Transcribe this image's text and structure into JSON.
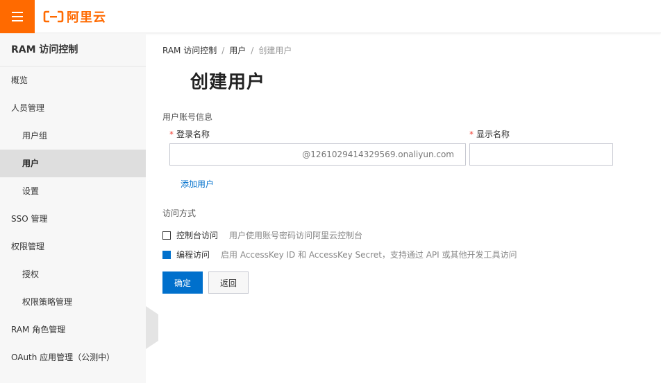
{
  "header": {
    "brand_text": "阿里云",
    "brand_color": "#ff6a00",
    "menu_icon": "hamburger-icon"
  },
  "sidebar": {
    "title": "RAM 访问控制",
    "items": [
      {
        "label": "概览"
      },
      {
        "label": "人员管理"
      },
      {
        "label": "用户组"
      },
      {
        "label": "用户"
      },
      {
        "label": "设置"
      },
      {
        "label": "SSO 管理"
      },
      {
        "label": "权限管理"
      },
      {
        "label": "授权"
      },
      {
        "label": "权限策略管理"
      },
      {
        "label": "RAM 角色管理"
      },
      {
        "label": "OAuth 应用管理（公测中）"
      }
    ],
    "active_item": "用户"
  },
  "breadcrumb": {
    "items": [
      "RAM 访问控制",
      "用户",
      "创建用户"
    ],
    "separator": "/"
  },
  "page": {
    "title": "创建用户"
  },
  "form": {
    "section_label": "用户账号信息",
    "required_mark": "*",
    "login_name_label": "登录名称",
    "login_name_value": "",
    "login_name_suffix": "@1261029414329569.onaliyun.com",
    "display_name_label": "显示名称",
    "display_name_value": "",
    "add_user_label": "添加用户",
    "access_label": "访问方式",
    "console_access_label": "控制台访问",
    "console_access_desc": "用户使用账号密码访问阿里云控制台",
    "console_access_checked": false,
    "programmatic_access_label": "编程访问",
    "programmatic_access_desc": "启用 AccessKey ID 和 AccessKey Secret，支持通过 API 或其他开发工具访问",
    "programmatic_access_checked": true,
    "confirm_label": "确定",
    "back_label": "返回"
  },
  "colors": {
    "primary": "#0070cc",
    "accent": "#ff6a00",
    "required": "#f04134"
  }
}
